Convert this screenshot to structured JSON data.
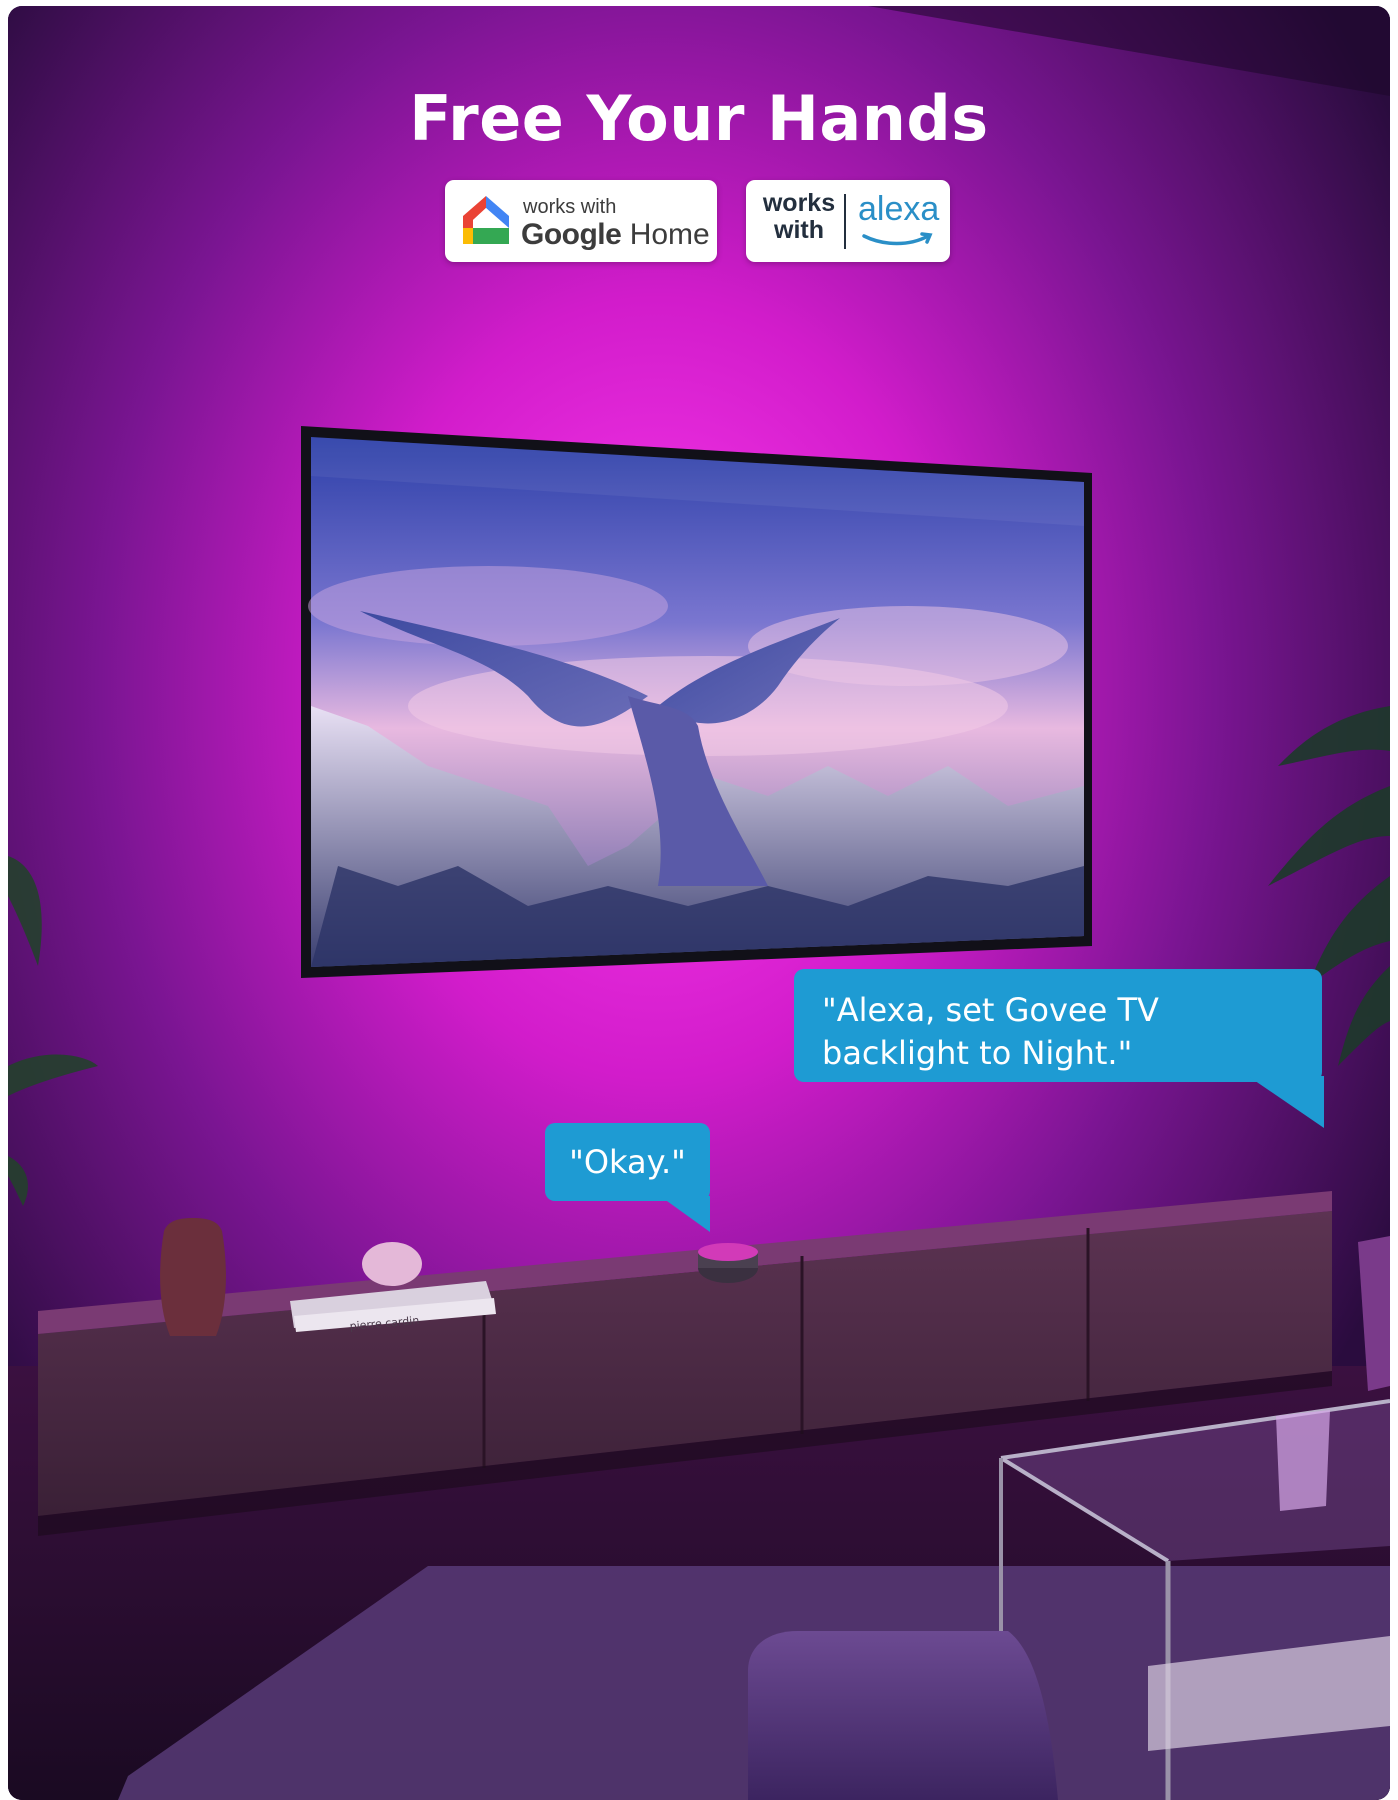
{
  "headline": "Free Your Hands",
  "badges": {
    "google": {
      "top_text": "works with",
      "google_word": "Google",
      "home_word": "Home",
      "icon": "google-home-icon"
    },
    "alexa": {
      "works": "works",
      "with": "with",
      "word": "alexa",
      "icon": "alexa-smile-icon"
    }
  },
  "bubbles": {
    "alexa_command": "\"Alexa, set Govee TV backlight to Night.\"",
    "reply": "\"Okay.\""
  },
  "scene": {
    "book_spine": "pierre cardin",
    "colors": {
      "backlight": "#ff2ee8",
      "bubble": "#1e9bd3",
      "wall": "#5a1670"
    }
  }
}
